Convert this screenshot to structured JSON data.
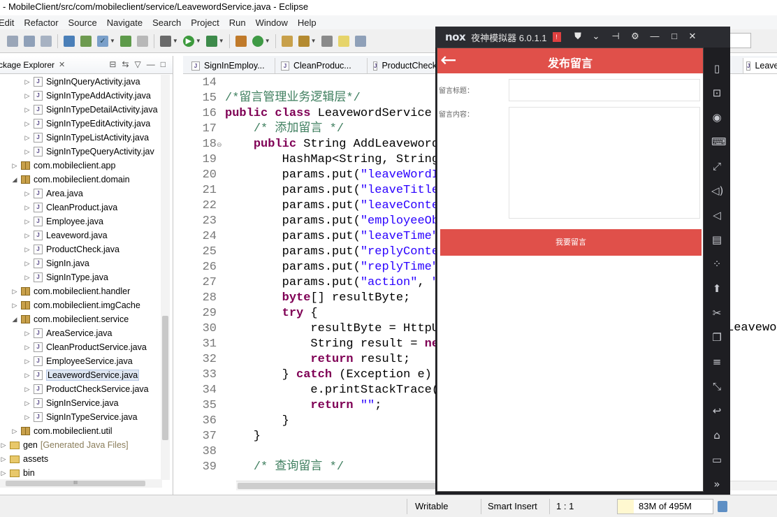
{
  "window": {
    "title": "- MobileClient/src/com/mobileclient/service/LeavewordService.java - Eclipse"
  },
  "menu": [
    "Edit",
    "Refactor",
    "Source",
    "Navigate",
    "Search",
    "Project",
    "Run",
    "Window",
    "Help"
  ],
  "package_explorer": {
    "title": "ckage Explorer",
    "rows": [
      {
        "label": "SignInQueryActivity.java",
        "kind": "file"
      },
      {
        "label": "SignInTypeAddActivity.java",
        "kind": "file"
      },
      {
        "label": "SignInTypeDetailActivity.java",
        "kind": "file"
      },
      {
        "label": "SignInTypeEditActivity.java",
        "kind": "file"
      },
      {
        "label": "SignInTypeListActivity.java",
        "kind": "file"
      },
      {
        "label": "SignInTypeQueryActivity.jav",
        "kind": "file"
      },
      {
        "label": "com.mobileclient.app",
        "kind": "package"
      },
      {
        "label": "com.mobileclient.domain",
        "kind": "package"
      },
      {
        "label": "Area.java",
        "kind": "file"
      },
      {
        "label": "CleanProduct.java",
        "kind": "file"
      },
      {
        "label": "Employee.java",
        "kind": "file"
      },
      {
        "label": "Leaveword.java",
        "kind": "file"
      },
      {
        "label": "ProductCheck.java",
        "kind": "file"
      },
      {
        "label": "SignIn.java",
        "kind": "file"
      },
      {
        "label": "SignInType.java",
        "kind": "file"
      },
      {
        "label": "com.mobileclient.handler",
        "kind": "package"
      },
      {
        "label": "com.mobileclient.imgCache",
        "kind": "package"
      },
      {
        "label": "com.mobileclient.service",
        "kind": "package"
      },
      {
        "label": "AreaService.java",
        "kind": "file"
      },
      {
        "label": "CleanProductService.java",
        "kind": "file"
      },
      {
        "label": "EmployeeService.java",
        "kind": "file"
      },
      {
        "label": "LeavewordService.java",
        "kind": "file"
      },
      {
        "label": "ProductCheckService.java",
        "kind": "file"
      },
      {
        "label": "SignInService.java",
        "kind": "file"
      },
      {
        "label": "SignInTypeService.java",
        "kind": "file"
      },
      {
        "label": "com.mobileclient.util",
        "kind": "package"
      },
      {
        "label": "gen",
        "kind": "folder"
      },
      {
        "label": "assets",
        "kind": "folder"
      },
      {
        "label": "bin",
        "kind": "folder"
      }
    ],
    "gen_suffix": "[Generated Java Files]"
  },
  "editor": {
    "tabs": [
      "SignInEmploy...",
      "CleanProduc...",
      "ProductCheck",
      "Leavew"
    ],
    "line_numbers": [
      "14",
      "15",
      "16",
      "17",
      "18",
      "19",
      "20",
      "21",
      "22",
      "23",
      "24",
      "25",
      "26",
      "27",
      "28",
      "29",
      "30",
      "31",
      "32",
      "33",
      "34",
      "35",
      "36",
      "37",
      "38",
      "39"
    ],
    "lines": [
      [],
      [
        {
          "t": "/*留言管理业务逻辑层*/",
          "c": "cm"
        }
      ],
      [
        {
          "t": "public",
          "c": "kw"
        },
        {
          "t": " "
        },
        {
          "t": "class",
          "c": "kw"
        },
        {
          "t": " LeavewordService"
        }
      ],
      [
        {
          "t": "    "
        },
        {
          "t": "/* 添加留言 */",
          "c": "cm"
        }
      ],
      [
        {
          "t": "    "
        },
        {
          "t": "public",
          "c": "kw"
        },
        {
          "t": " String AddLeaveword"
        }
      ],
      [
        {
          "t": "        HashMap<String, String"
        }
      ],
      [
        {
          "t": "        params.put("
        },
        {
          "t": "\"leaveWordI",
          "c": "str"
        }
      ],
      [
        {
          "t": "        params.put("
        },
        {
          "t": "\"leaveTitle",
          "c": "str"
        }
      ],
      [
        {
          "t": "        params.put("
        },
        {
          "t": "\"leaveConte",
          "c": "str"
        }
      ],
      [
        {
          "t": "        params.put("
        },
        {
          "t": "\"employeeOb",
          "c": "str"
        }
      ],
      [
        {
          "t": "        params.put("
        },
        {
          "t": "\"leaveTime\"",
          "c": "str"
        }
      ],
      [
        {
          "t": "        params.put("
        },
        {
          "t": "\"replyConte",
          "c": "str"
        }
      ],
      [
        {
          "t": "        params.put("
        },
        {
          "t": "\"replyTime\"",
          "c": "str"
        }
      ],
      [
        {
          "t": "        params.put("
        },
        {
          "t": "\"action\"",
          "c": "str"
        },
        {
          "t": ", "
        },
        {
          "t": "\"",
          "c": "str"
        }
      ],
      [
        {
          "t": "        "
        },
        {
          "t": "byte",
          "c": "kw"
        },
        {
          "t": "[] resultByte;"
        }
      ],
      [
        {
          "t": "        "
        },
        {
          "t": "try",
          "c": "kw"
        },
        {
          "t": " {"
        }
      ],
      [
        {
          "t": "            resultByte = HttpU"
        }
      ],
      [
        {
          "t": "            String result = "
        },
        {
          "t": "ne",
          "c": "kw"
        }
      ],
      [
        {
          "t": "            "
        },
        {
          "t": "return",
          "c": "kw"
        },
        {
          "t": " result;"
        }
      ],
      [
        {
          "t": "        } "
        },
        {
          "t": "catch",
          "c": "kw"
        },
        {
          "t": " (Exception e)"
        }
      ],
      [
        {
          "t": "            e.printStackTrace("
        }
      ],
      [
        {
          "t": "            "
        },
        {
          "t": "return",
          "c": "kw"
        },
        {
          "t": " "
        },
        {
          "t": "\"\"",
          "c": "str"
        },
        {
          "t": ";"
        }
      ],
      [
        {
          "t": "        }"
        }
      ],
      [
        {
          "t": "    }"
        }
      ],
      [],
      [
        {
          "t": "    "
        },
        {
          "t": "/* 查询留言 */",
          "c": "cm"
        }
      ]
    ],
    "overflow_text": "Leavewor"
  },
  "status": {
    "writable": "Writable",
    "insert_mode": "Smart Insert",
    "position": "1 : 1",
    "heap": "83M of 495M",
    "heap_used_fraction": 0.17
  },
  "nox": {
    "logo": "nox",
    "title": "夜神模拟器 6.0.1.1",
    "app": {
      "header_title": "发布留言",
      "label_title": "留言标题：",
      "label_content": "留言内容：",
      "submit_label": "我要留言"
    },
    "sidebar_icons": [
      "phone-icon",
      "robot-icon",
      "location-icon",
      "keyboard-icon",
      "fullscreen-icon",
      "volume-up-icon",
      "volume-down-icon",
      "toolbox-icon",
      "shake-icon",
      "apk-icon",
      "scissors-icon",
      "multi-instance-icon",
      "menu-icon",
      "resize-icon",
      "back-icon",
      "home-icon",
      "recent-apps-icon",
      "more-icon"
    ]
  },
  "colors": {
    "app_accent": "#e0504a",
    "keyword": "#7f0055",
    "comment": "#3f7f5f",
    "string": "#2a00ff"
  }
}
